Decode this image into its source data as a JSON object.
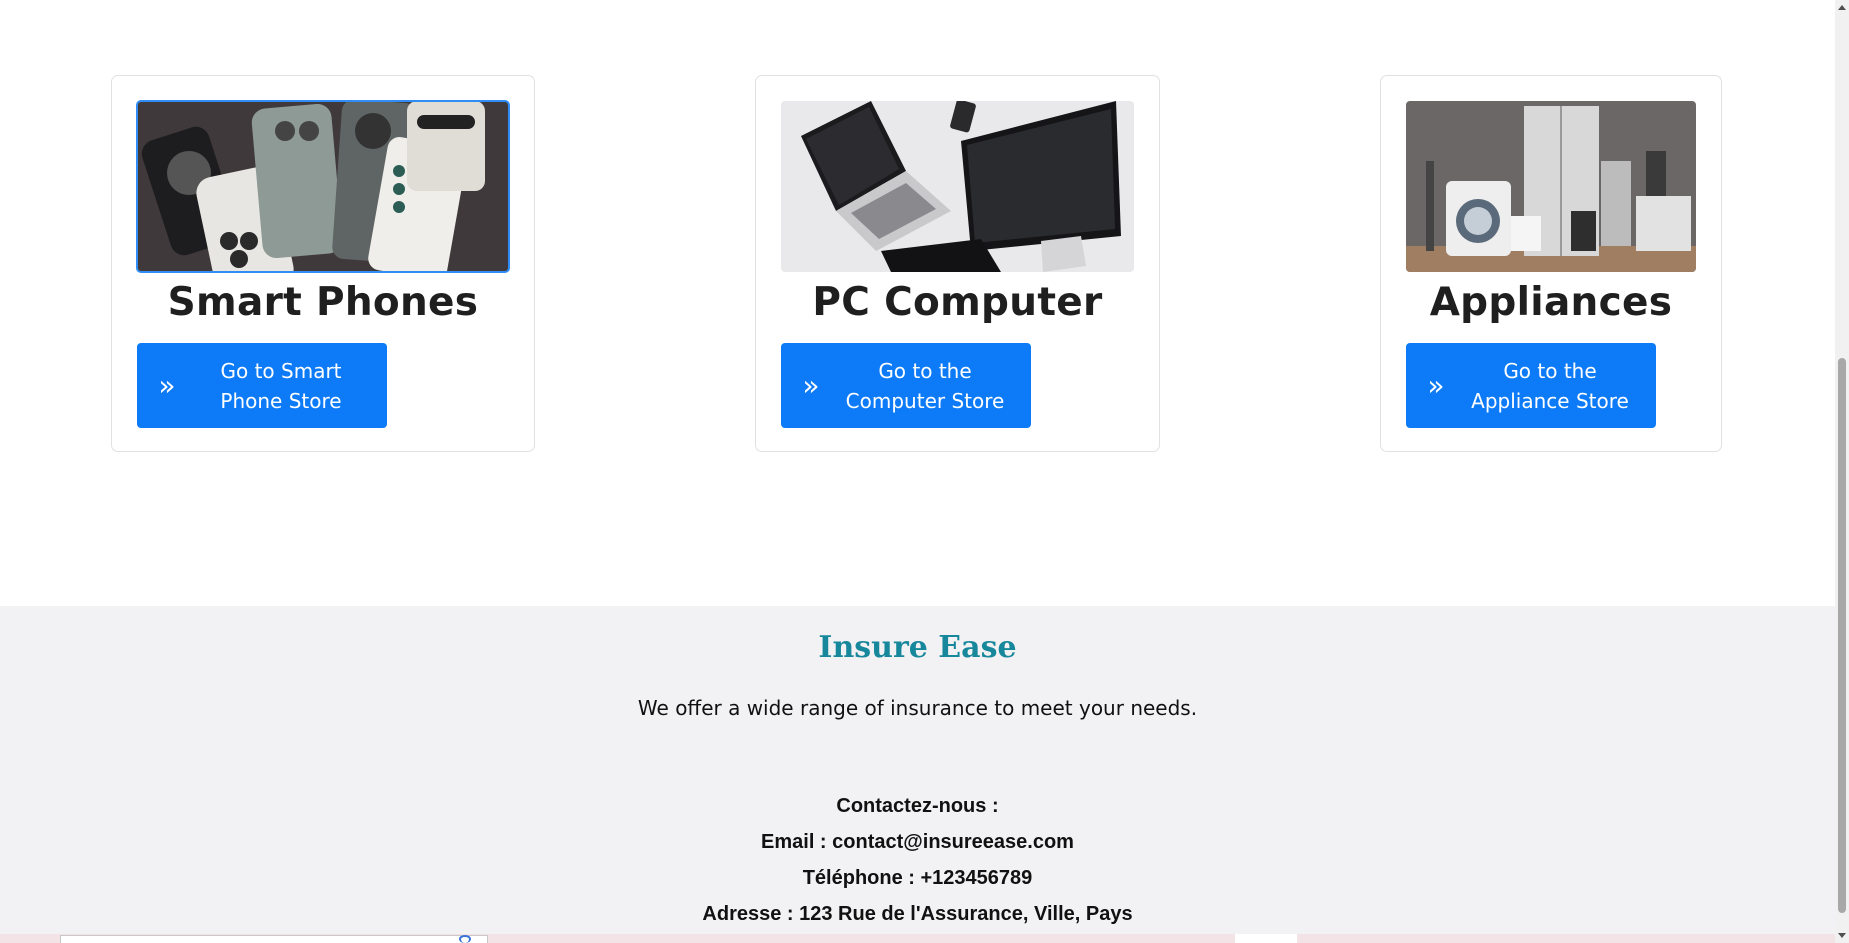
{
  "cards": [
    {
      "title": "Smart Phones",
      "button": "Go to Smart\nPhone Store",
      "image": "smart-phones-photo"
    },
    {
      "title": "PC Computer",
      "button": "Go to the\nComputer Store",
      "image": "pc-computer-photo"
    },
    {
      "title": "Appliances",
      "button": "Go to the\nAppliance Store",
      "image": "appliances-photo"
    }
  ],
  "footer": {
    "brand": "Insure Ease",
    "tagline": "We offer a wide range of insurance to meet your needs.",
    "contact_heading": "Contactez-nous :",
    "email": "Email : contact@insureease.com",
    "phone": "Téléphone : +123456789",
    "address": "Adresse : 123 Rue de l'Assurance, Ville, Pays"
  },
  "colors": {
    "button": "#0d7bf7",
    "brand": "#17879b",
    "footer_bg": "#f2f2f4"
  },
  "icons": {
    "button": "double-chevron-right-icon"
  }
}
